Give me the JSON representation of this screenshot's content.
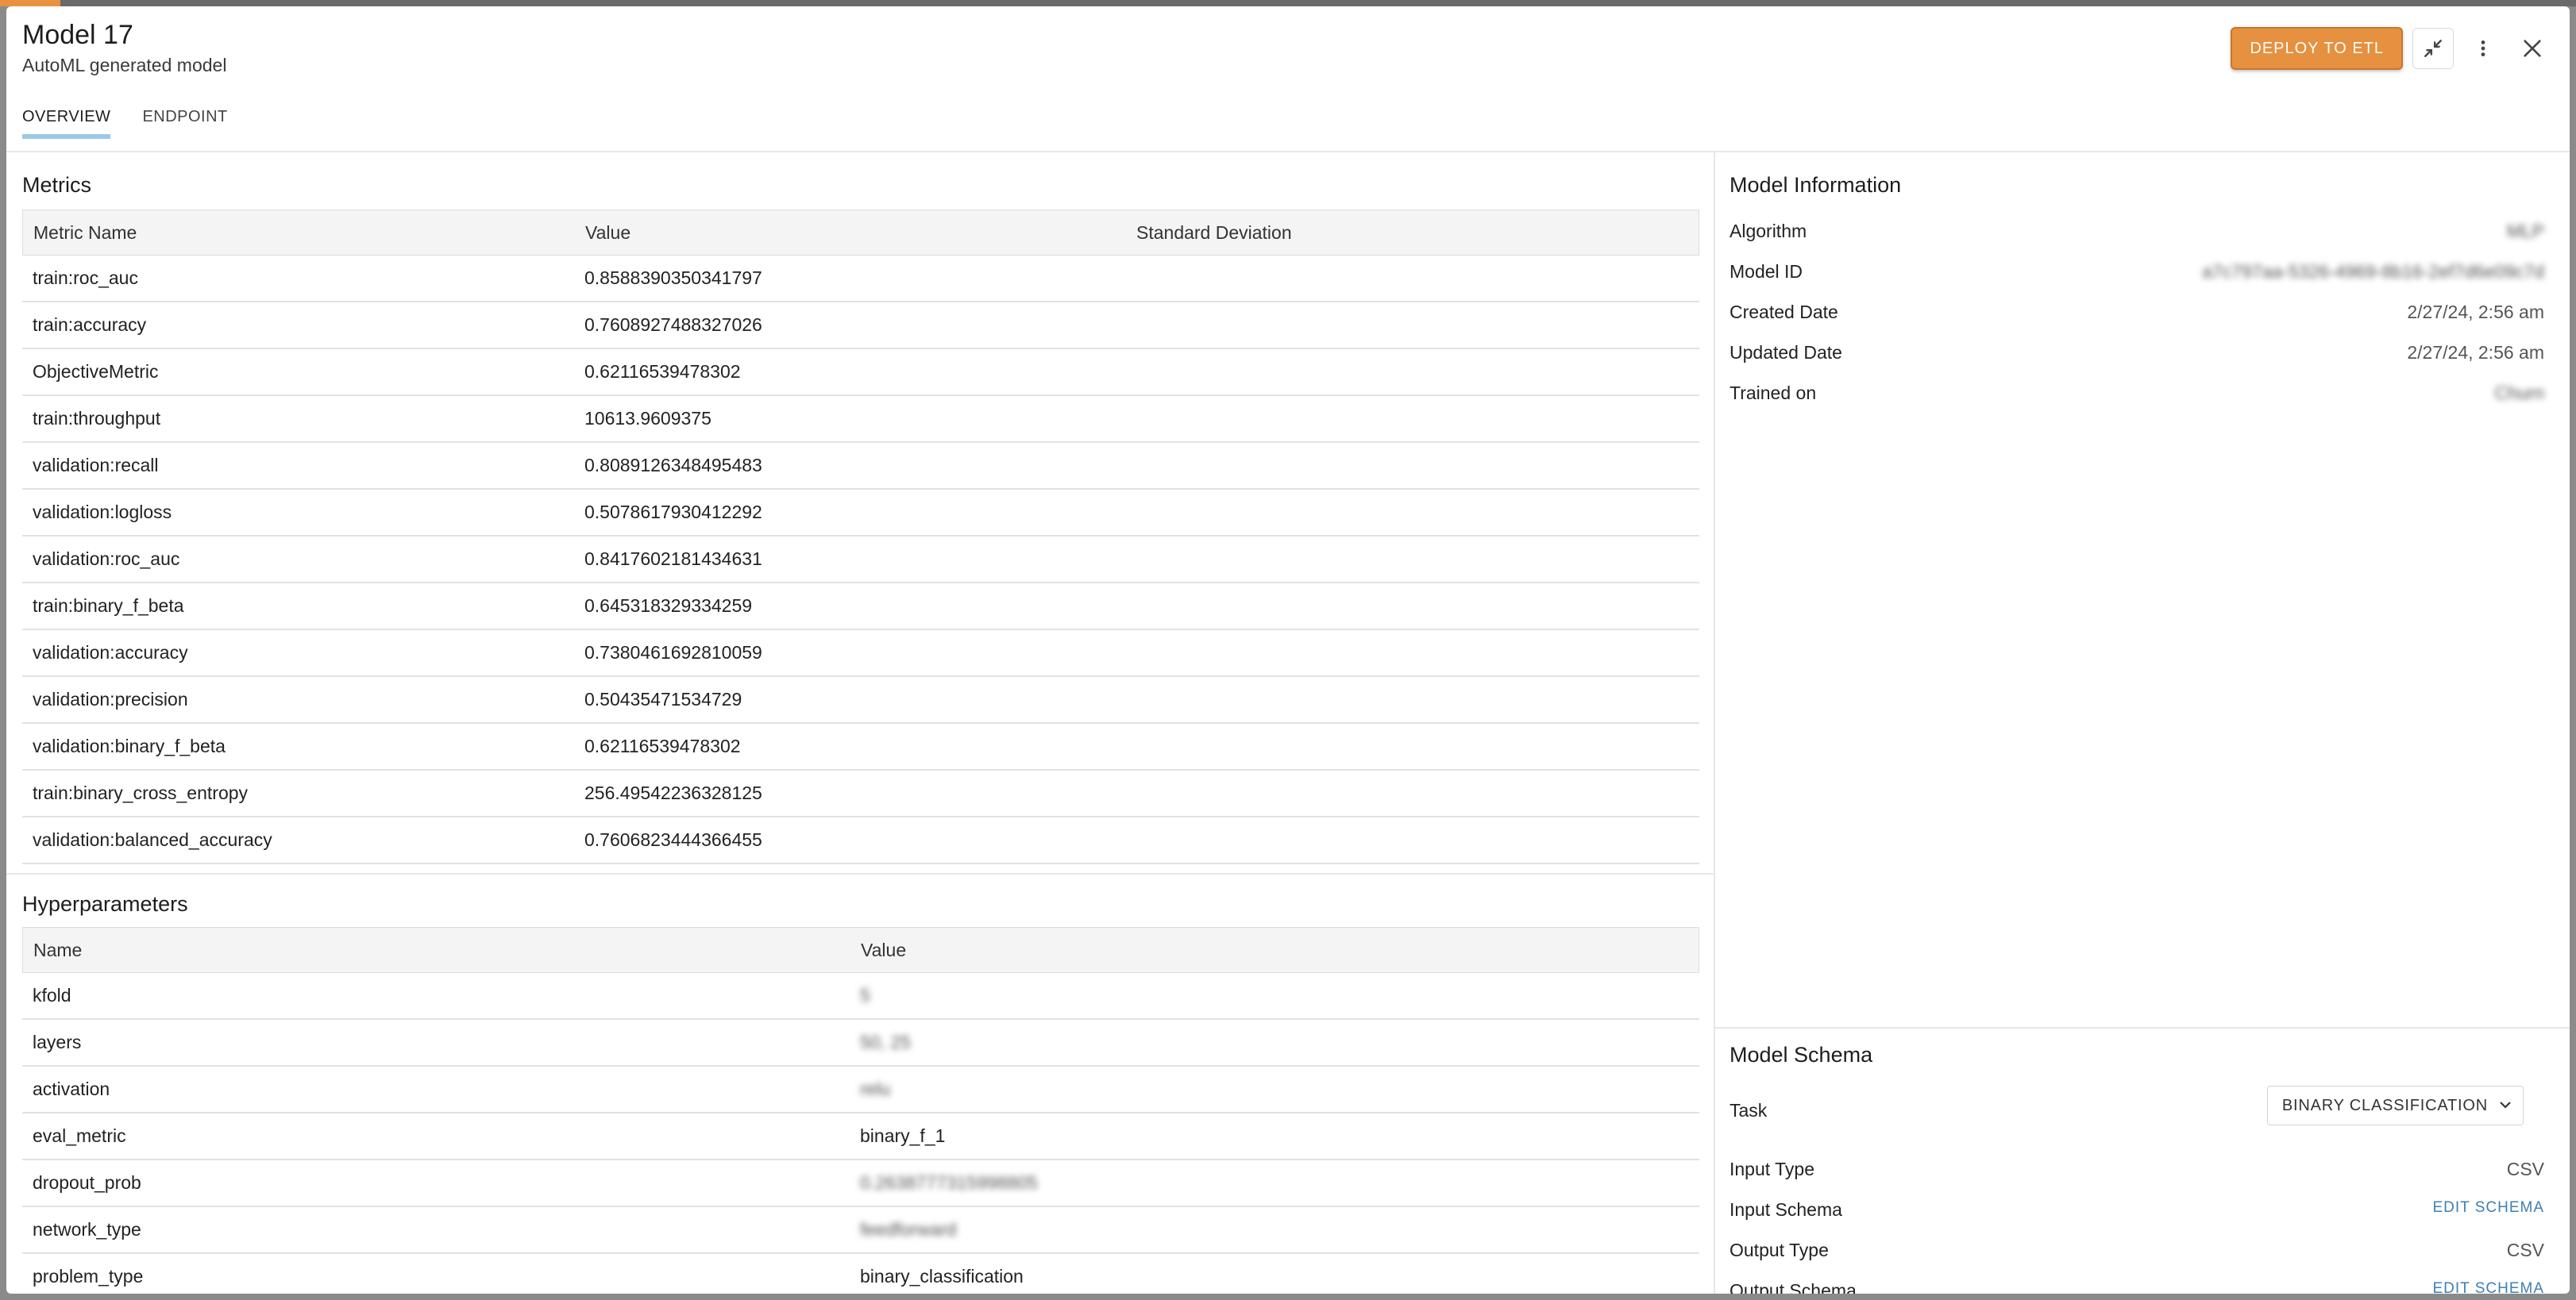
{
  "header": {
    "title": "Model 17",
    "subtitle": "AutoML generated model",
    "deploy_label": "DEPLOY TO ETL"
  },
  "tabs": [
    {
      "label": "OVERVIEW",
      "active": true
    },
    {
      "label": "ENDPOINT",
      "active": false
    }
  ],
  "metrics": {
    "title": "Metrics",
    "columns": [
      "Metric Name",
      "Value",
      "Standard Deviation"
    ],
    "rows": [
      {
        "name": "train:roc_auc",
        "value": "0.8588390350341797",
        "std": ""
      },
      {
        "name": "train:accuracy",
        "value": "0.7608927488327026",
        "std": ""
      },
      {
        "name": "ObjectiveMetric",
        "value": "0.62116539478302",
        "std": ""
      },
      {
        "name": "train:throughput",
        "value": "10613.9609375",
        "std": ""
      },
      {
        "name": "validation:recall",
        "value": "0.8089126348495483",
        "std": ""
      },
      {
        "name": "validation:logloss",
        "value": "0.5078617930412292",
        "std": ""
      },
      {
        "name": "validation:roc_auc",
        "value": "0.8417602181434631",
        "std": ""
      },
      {
        "name": "train:binary_f_beta",
        "value": "0.645318329334259",
        "std": ""
      },
      {
        "name": "validation:accuracy",
        "value": "0.7380461692810059",
        "std": ""
      },
      {
        "name": "validation:precision",
        "value": "0.50435471534729",
        "std": ""
      },
      {
        "name": "validation:binary_f_beta",
        "value": "0.62116539478302",
        "std": ""
      },
      {
        "name": "train:binary_cross_entropy",
        "value": "256.49542236328125",
        "std": ""
      },
      {
        "name": "validation:balanced_accuracy",
        "value": "0.7606823444366455",
        "std": ""
      }
    ]
  },
  "hyperparameters": {
    "title": "Hyperparameters",
    "columns": [
      "Name",
      "Value"
    ],
    "rows": [
      {
        "name": "kfold",
        "value": "5",
        "blurred": true
      },
      {
        "name": "layers",
        "value": "50, 25",
        "blurred": true
      },
      {
        "name": "activation",
        "value": "relu",
        "blurred": true
      },
      {
        "name": "eval_metric",
        "value": "binary_f_1",
        "blurred": false
      },
      {
        "name": "dropout_prob",
        "value": "0.2638777315998805",
        "blurred": true
      },
      {
        "name": "network_type",
        "value": "feedforward",
        "blurred": true
      },
      {
        "name": "problem_type",
        "value": "binary_classification",
        "blurred": false
      }
    ]
  },
  "model_info": {
    "title": "Model Information",
    "rows": [
      {
        "label": "Algorithm",
        "value": "MLP",
        "blurred": true
      },
      {
        "label": "Model ID",
        "value": "a7c797aa-5326-4969-8b16-2ef7d6e09c7d",
        "blurred": true
      },
      {
        "label": "Created Date",
        "value": "2/27/24, 2:56 am",
        "blurred": false
      },
      {
        "label": "Updated Date",
        "value": "2/27/24, 2:56 am",
        "blurred": false
      },
      {
        "label": "Trained on",
        "value": "Churn",
        "blurred": true
      }
    ]
  },
  "model_schema": {
    "title": "Model Schema",
    "task_label": "Task",
    "task_value": "BINARY CLASSIFICATION",
    "rows": [
      {
        "label": "Input Type",
        "value": "CSV",
        "link": false
      },
      {
        "label": "Input Schema",
        "value": "EDIT SCHEMA",
        "link": true
      },
      {
        "label": "Output Type",
        "value": "CSV",
        "link": false
      },
      {
        "label": "Output Schema",
        "value": "EDIT SCHEMA",
        "link": true
      }
    ]
  },
  "colors": {
    "accent": "#e5913f",
    "link": "#3f7fb5",
    "tab_indicator": "#9cc8e8"
  }
}
